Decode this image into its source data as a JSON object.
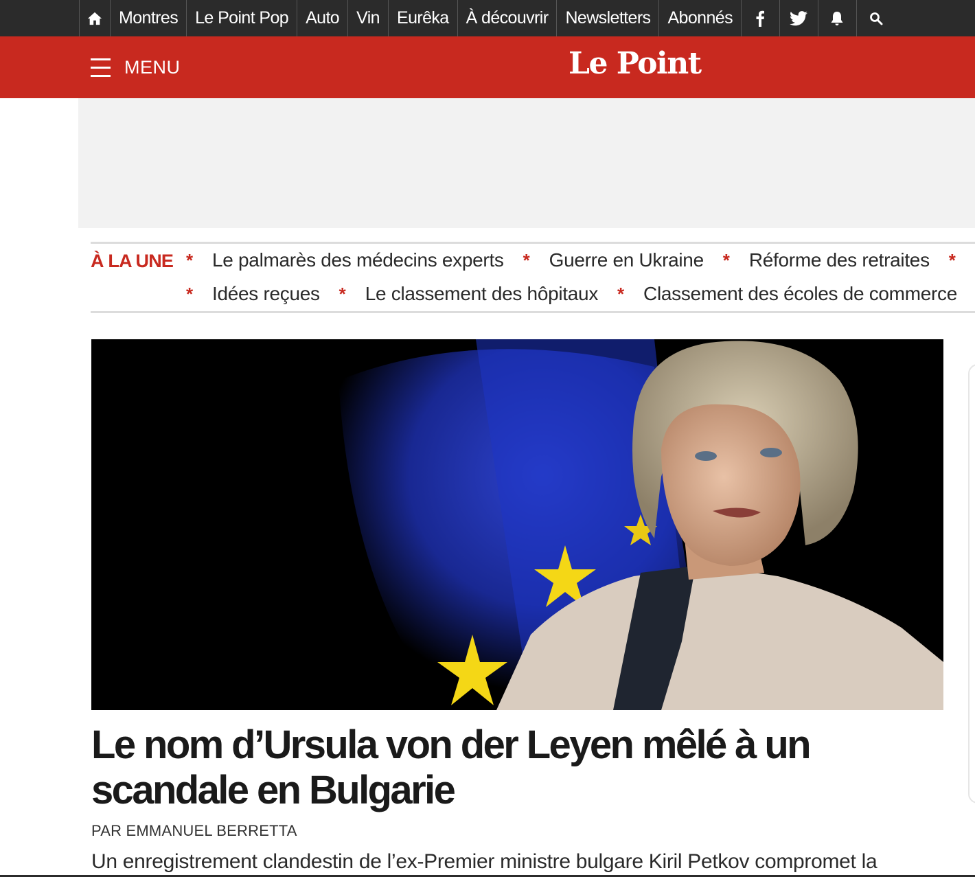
{
  "topnav": {
    "home_icon": "home-icon",
    "items": [
      "Montres",
      "Le Point Pop",
      "Auto",
      "Vin",
      "Eurêka",
      "À découvrir",
      "Newsletters",
      "Abonnés"
    ],
    "icons": [
      "facebook-icon",
      "twitter-icon",
      "bell-icon",
      "search-icon"
    ]
  },
  "header": {
    "menu_label": "MENU",
    "logo": "Le Point",
    "brand_color": "#c8291f"
  },
  "une": {
    "title": "À LA UNE",
    "row1": [
      "Le palmarès des médecins experts",
      "Guerre en Ukraine",
      "Réforme des retraites"
    ],
    "row2": [
      "Idées reçues",
      "Le classement des hôpitaux",
      "Classement des écoles de commerce"
    ]
  },
  "article": {
    "headline": "Le nom d’Ursula von der Leyen mêlé à un scandale en Bulgarie",
    "byline": "PAR EMMANUEL BERRETTA",
    "lede": "Un enregistrement clandestin de l’ex-Premier ministre bulgare Kiril Petkov compromet la"
  }
}
